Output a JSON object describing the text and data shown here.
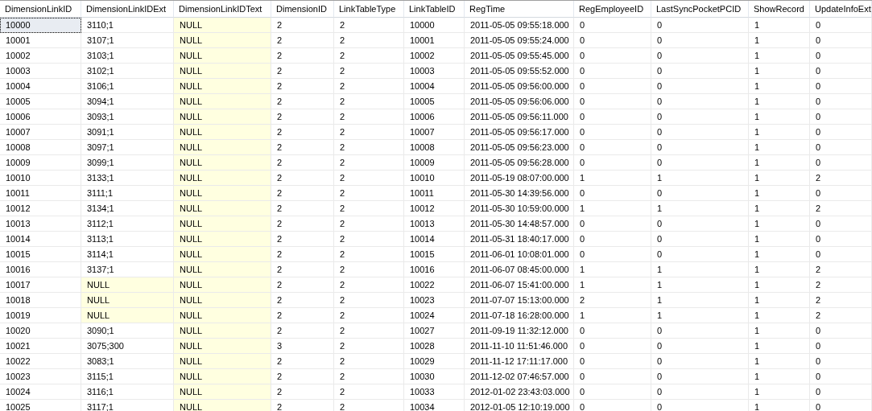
{
  "table": {
    "columns": [
      "DimensionLinkID",
      "DimensionLinkIDExt",
      "DimensionLinkIDText",
      "DimensionID",
      "LinkTableType",
      "LinkTableID",
      "RegTime",
      "RegEmployeeID",
      "LastSyncPocketPCID",
      "ShowRecord",
      "UpdateInfoExt"
    ],
    "rows": [
      {
        "selected": true,
        "cells": [
          "10000",
          "3110;1",
          {
            "text": "NULL",
            "is_null": true
          },
          "2",
          "2",
          "10000",
          "2011-05-05 09:55:18.000",
          "0",
          "0",
          "1",
          "0"
        ]
      },
      {
        "selected": false,
        "cells": [
          "10001",
          "3107;1",
          {
            "text": "NULL",
            "is_null": true
          },
          "2",
          "2",
          "10001",
          "2011-05-05 09:55:24.000",
          "0",
          "0",
          "1",
          "0"
        ]
      },
      {
        "selected": false,
        "cells": [
          "10002",
          "3103;1",
          {
            "text": "NULL",
            "is_null": true
          },
          "2",
          "2",
          "10002",
          "2011-05-05 09:55:45.000",
          "0",
          "0",
          "1",
          "0"
        ]
      },
      {
        "selected": false,
        "cells": [
          "10003",
          "3102;1",
          {
            "text": "NULL",
            "is_null": true
          },
          "2",
          "2",
          "10003",
          "2011-05-05 09:55:52.000",
          "0",
          "0",
          "1",
          "0"
        ]
      },
      {
        "selected": false,
        "cells": [
          "10004",
          "3106;1",
          {
            "text": "NULL",
            "is_null": true
          },
          "2",
          "2",
          "10004",
          "2011-05-05 09:56:00.000",
          "0",
          "0",
          "1",
          "0"
        ]
      },
      {
        "selected": false,
        "cells": [
          "10005",
          "3094;1",
          {
            "text": "NULL",
            "is_null": true
          },
          "2",
          "2",
          "10005",
          "2011-05-05 09:56:06.000",
          "0",
          "0",
          "1",
          "0"
        ]
      },
      {
        "selected": false,
        "cells": [
          "10006",
          "3093;1",
          {
            "text": "NULL",
            "is_null": true
          },
          "2",
          "2",
          "10006",
          "2011-05-05 09:56:11.000",
          "0",
          "0",
          "1",
          "0"
        ]
      },
      {
        "selected": false,
        "cells": [
          "10007",
          "3091;1",
          {
            "text": "NULL",
            "is_null": true
          },
          "2",
          "2",
          "10007",
          "2011-05-05 09:56:17.000",
          "0",
          "0",
          "1",
          "0"
        ]
      },
      {
        "selected": false,
        "cells": [
          "10008",
          "3097;1",
          {
            "text": "NULL",
            "is_null": true
          },
          "2",
          "2",
          "10008",
          "2011-05-05 09:56:23.000",
          "0",
          "0",
          "1",
          "0"
        ]
      },
      {
        "selected": false,
        "cells": [
          "10009",
          "3099;1",
          {
            "text": "NULL",
            "is_null": true
          },
          "2",
          "2",
          "10009",
          "2011-05-05 09:56:28.000",
          "0",
          "0",
          "1",
          "0"
        ]
      },
      {
        "selected": false,
        "cells": [
          "10010",
          "3133;1",
          {
            "text": "NULL",
            "is_null": true
          },
          "2",
          "2",
          "10010",
          "2011-05-19 08:07:00.000",
          "1",
          "1",
          "1",
          "2"
        ]
      },
      {
        "selected": false,
        "cells": [
          "10011",
          "3111;1",
          {
            "text": "NULL",
            "is_null": true
          },
          "2",
          "2",
          "10011",
          "2011-05-30 14:39:56.000",
          "0",
          "0",
          "1",
          "0"
        ]
      },
      {
        "selected": false,
        "cells": [
          "10012",
          "3134;1",
          {
            "text": "NULL",
            "is_null": true
          },
          "2",
          "2",
          "10012",
          "2011-05-30 10:59:00.000",
          "1",
          "1",
          "1",
          "2"
        ]
      },
      {
        "selected": false,
        "cells": [
          "10013",
          "3112;1",
          {
            "text": "NULL",
            "is_null": true
          },
          "2",
          "2",
          "10013",
          "2011-05-30 14:48:57.000",
          "0",
          "0",
          "1",
          "0"
        ]
      },
      {
        "selected": false,
        "cells": [
          "10014",
          "3113;1",
          {
            "text": "NULL",
            "is_null": true
          },
          "2",
          "2",
          "10014",
          "2011-05-31 18:40:17.000",
          "0",
          "0",
          "1",
          "0"
        ]
      },
      {
        "selected": false,
        "cells": [
          "10015",
          "3114;1",
          {
            "text": "NULL",
            "is_null": true
          },
          "2",
          "2",
          "10015",
          "2011-06-01 10:08:01.000",
          "0",
          "0",
          "1",
          "0"
        ]
      },
      {
        "selected": false,
        "cells": [
          "10016",
          "3137;1",
          {
            "text": "NULL",
            "is_null": true
          },
          "2",
          "2",
          "10016",
          "2011-06-07 08:45:00.000",
          "1",
          "1",
          "1",
          "2"
        ]
      },
      {
        "selected": false,
        "cells": [
          "10017",
          {
            "text": "NULL",
            "is_null": true
          },
          {
            "text": "NULL",
            "is_null": true
          },
          "2",
          "2",
          "10022",
          "2011-06-07 15:41:00.000",
          "1",
          "1",
          "1",
          "2"
        ]
      },
      {
        "selected": false,
        "cells": [
          "10018",
          {
            "text": "NULL",
            "is_null": true
          },
          {
            "text": "NULL",
            "is_null": true
          },
          "2",
          "2",
          "10023",
          "2011-07-07 15:13:00.000",
          "2",
          "1",
          "1",
          "2"
        ]
      },
      {
        "selected": false,
        "cells": [
          "10019",
          {
            "text": "NULL",
            "is_null": true
          },
          {
            "text": "NULL",
            "is_null": true
          },
          "2",
          "2",
          "10024",
          "2011-07-18 16:28:00.000",
          "1",
          "1",
          "1",
          "2"
        ]
      },
      {
        "selected": false,
        "cells": [
          "10020",
          "3090;1",
          {
            "text": "NULL",
            "is_null": true
          },
          "2",
          "2",
          "10027",
          "2011-09-19 11:32:12.000",
          "0",
          "0",
          "1",
          "0"
        ]
      },
      {
        "selected": false,
        "cells": [
          "10021",
          "3075;300",
          {
            "text": "NULL",
            "is_null": true
          },
          "3",
          "2",
          "10028",
          "2011-11-10 11:51:46.000",
          "0",
          "0",
          "1",
          "0"
        ]
      },
      {
        "selected": false,
        "cells": [
          "10022",
          "3083;1",
          {
            "text": "NULL",
            "is_null": true
          },
          "2",
          "2",
          "10029",
          "2011-11-12 17:11:17.000",
          "0",
          "0",
          "1",
          "0"
        ]
      },
      {
        "selected": false,
        "cells": [
          "10023",
          "3115;1",
          {
            "text": "NULL",
            "is_null": true
          },
          "2",
          "2",
          "10030",
          "2011-12-02 07:46:57.000",
          "0",
          "0",
          "1",
          "0"
        ]
      },
      {
        "selected": false,
        "cells": [
          "10024",
          "3116;1",
          {
            "text": "NULL",
            "is_null": true
          },
          "2",
          "2",
          "10033",
          "2012-01-02 23:43:03.000",
          "0",
          "0",
          "1",
          "0"
        ]
      },
      {
        "selected": false,
        "cells": [
          "10025",
          "3117;1",
          {
            "text": "NULL",
            "is_null": true
          },
          "2",
          "2",
          "10034",
          "2012-01-05 12:10:19.000",
          "0",
          "0",
          "1",
          "0"
        ]
      }
    ]
  }
}
